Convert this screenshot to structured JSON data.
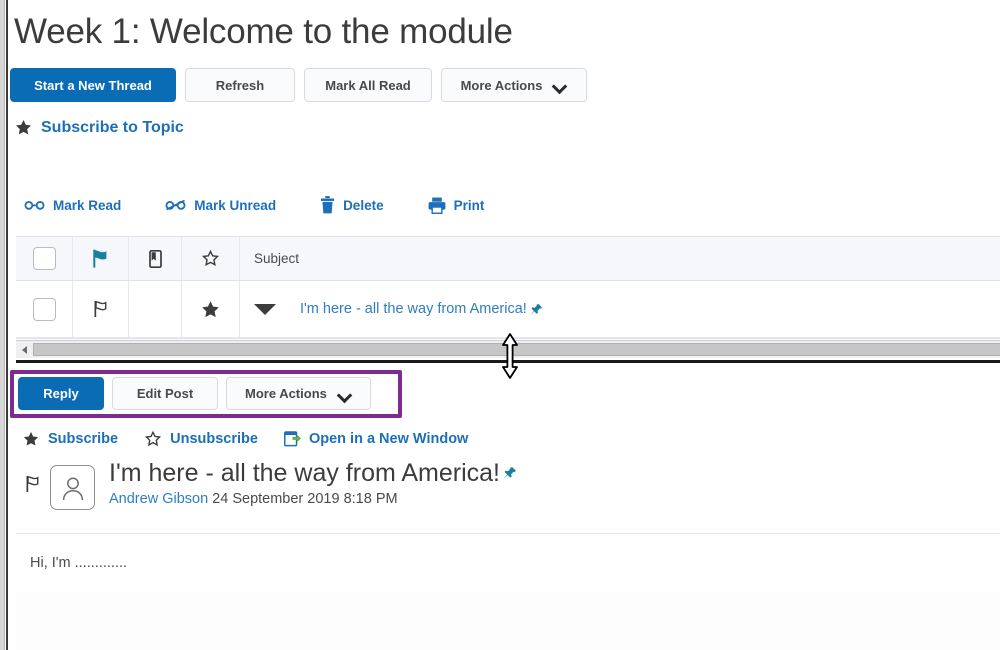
{
  "page": {
    "title": "Week 1: Welcome to the module"
  },
  "colors": {
    "primary_blue": "#0a6cb5",
    "link_blue": "#1d6fb9",
    "subject_blue": "#2f7dc4",
    "highlight_purple": "#7d2a91",
    "flag_teal": "#1a7e9e",
    "text_dark": "#3c3c3c",
    "header_row_bg": "#f6f7fb"
  },
  "toolbar": {
    "start_thread": "Start a New Thread",
    "refresh": "Refresh",
    "mark_all_read": "Mark All Read",
    "more_actions": "More Actions"
  },
  "subscribe_topic": {
    "label": "Subscribe to Topic",
    "icon": "star-filled-icon"
  },
  "actions": [
    {
      "label": "Mark Read",
      "icon": "glasses-icon"
    },
    {
      "label": "Mark Unread",
      "icon": "glasses-crossed-icon"
    },
    {
      "label": "Delete",
      "icon": "trash-icon"
    },
    {
      "label": "Print",
      "icon": "printer-icon"
    }
  ],
  "threads_table": {
    "headers": {
      "select_all": "select-all-checkbox",
      "flag": "flag-icon",
      "attachment": "paperclip-icon",
      "star": "star-outline-icon",
      "subject": "Subject"
    },
    "rows": [
      {
        "checked": false,
        "flag": "flag-outline-icon",
        "attachment": "",
        "starred": true,
        "expand": "triangle-down-icon",
        "subject": "I'm here - all the way from America!",
        "pinned": true
      }
    ]
  },
  "scrollbar": {
    "left_arrow": "scroll-left-arrow-icon",
    "orientation": "horizontal"
  },
  "cursor": {
    "type": "resize-vertical-cursor"
  },
  "post_toolbar": {
    "reply": "Reply",
    "edit_post": "Edit Post",
    "more_actions": "More Actions",
    "highlighted": true
  },
  "post_links": [
    {
      "label": "Subscribe",
      "icon": "star-filled-icon"
    },
    {
      "label": "Unsubscribe",
      "icon": "star-outline-icon"
    },
    {
      "label": "Open in a New Window",
      "icon": "new-window-icon"
    }
  ],
  "post": {
    "flag_icon": "flag-outline-icon",
    "avatar": "user-avatar-placeholder",
    "title": "I'm here - all the way from America!",
    "pinned": true,
    "author": "Andrew Gibson",
    "date": "24 September 2019 8:18 PM",
    "body": "Hi, I'm ............."
  }
}
